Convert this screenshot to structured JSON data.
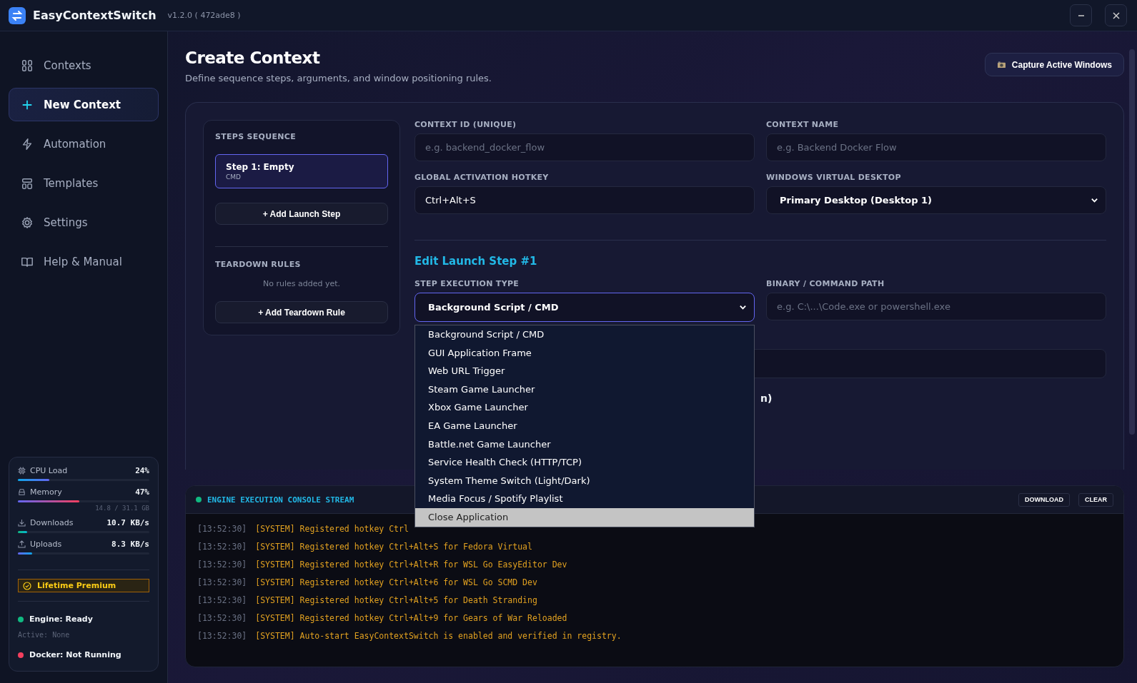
{
  "app": {
    "name": "EasyContextSwitch",
    "version": "v1.2.0 ( 472ade8 )"
  },
  "sidebar": {
    "items": [
      {
        "label": "Contexts",
        "selected": false
      },
      {
        "label": "New Context",
        "selected": true
      },
      {
        "label": "Automation",
        "selected": false
      },
      {
        "label": "Templates",
        "selected": false
      },
      {
        "label": "Settings",
        "selected": false
      },
      {
        "label": "Help & Manual",
        "selected": false
      }
    ],
    "stats": [
      {
        "label": "CPU Load",
        "value": "24%",
        "level": 0.24
      },
      {
        "label": "Memory",
        "value": "47%",
        "level": 0.47,
        "detail": "14.8 / 31.1 GB"
      },
      {
        "label": "Downloads",
        "value": "10.7 KB/s",
        "level": 0.07
      },
      {
        "label": "Uploads",
        "value": "8.3 KB/s",
        "level": 0.11
      }
    ],
    "badge": "Lifetime Premium",
    "status": [
      {
        "label": "Engine: Ready",
        "color": "#10b981",
        "detail": "Active: None"
      },
      {
        "label": "Docker: Not Running",
        "color": "#f43f5e"
      }
    ]
  },
  "page": {
    "title": "Create Context",
    "subtitle": "Define sequence steps, arguments, and window positioning rules.",
    "capture_button": "Capture Active Windows"
  },
  "steps": {
    "heading": "STEPS SEQUENCE",
    "items": [
      {
        "title": "Step 1: Empty",
        "type": "CMD",
        "selected": true
      }
    ],
    "add_button": "+ Add Launch Step",
    "teardown_heading": "TEARDOWN RULES",
    "teardown_empty": "No rules added yet.",
    "teardown_button": "+ Add Teardown Rule"
  },
  "form": {
    "fields": [
      {
        "label": "CONTEXT ID (UNIQUE)",
        "placeholder": "e.g. backend_docker_flow"
      },
      {
        "label": "CONTEXT NAME",
        "placeholder": "e.g. Backend Docker Flow"
      },
      {
        "label": "GLOBAL ACTIVATION HOTKEY",
        "value": "Ctrl+Alt+S"
      },
      {
        "label": "WINDOWS VIRTUAL DESKTOP",
        "value": "Primary Desktop (Desktop 1)",
        "kind": "select"
      }
    ],
    "step_heading": "Edit Launch Step #1",
    "step_type": {
      "label": "STEP EXECUTION TYPE",
      "value": "Background Script / CMD",
      "options": [
        {
          "label": "Background Script / CMD",
          "highlighted": false
        },
        {
          "label": "GUI Application Frame",
          "highlighted": false
        },
        {
          "label": "Web URL Trigger",
          "highlighted": false
        },
        {
          "label": "Steam Game Launcher",
          "highlighted": false
        },
        {
          "label": "Xbox Game Launcher",
          "highlighted": false
        },
        {
          "label": "EA Game Launcher",
          "highlighted": false
        },
        {
          "label": "Battle.net Game Launcher",
          "highlighted": false
        },
        {
          "label": "Service Health Check (HTTP/TCP)",
          "highlighted": false
        },
        {
          "label": "System Theme Switch (Light/Dark)",
          "highlighted": false
        },
        {
          "label": "Media Focus / Spotify Playlist",
          "highlighted": false
        },
        {
          "label": "Close Application",
          "highlighted": true
        }
      ]
    },
    "binary": {
      "label": "BINARY / COMMAND PATH",
      "placeholder": "e.g. C:\\...\\Code.exe or powershell.exe"
    },
    "hidden_label_tail": "n)"
  },
  "console": {
    "title": "ENGINE EXECUTION CONSOLE STREAM",
    "buttons": [
      "DOWNLOAD",
      "CLEAR"
    ],
    "lines": [
      {
        "time": "[13:52:30]",
        "text": "[SYSTEM] Registered hotkey Ctrl"
      },
      {
        "time": "[13:52:30]",
        "text": "[SYSTEM] Registered hotkey Ctrl+Alt+S for Fedora Virtual"
      },
      {
        "time": "[13:52:30]",
        "text": "[SYSTEM] Registered hotkey Ctrl+Alt+R for WSL Go EasyEditor Dev"
      },
      {
        "time": "[13:52:30]",
        "text": "[SYSTEM] Registered hotkey Ctrl+Alt+6 for WSL Go SCMD Dev"
      },
      {
        "time": "[13:52:30]",
        "text": "[SYSTEM] Registered hotkey Ctrl+Alt+5 for Death Stranding"
      },
      {
        "time": "[13:52:30]",
        "text": "[SYSTEM] Registered hotkey Ctrl+Alt+9 for Gears of War Reloaded"
      },
      {
        "time": "[13:52:30]",
        "text": "[SYSTEM] Auto-start EasyContextSwitch is enabled and verified in registry."
      }
    ]
  }
}
